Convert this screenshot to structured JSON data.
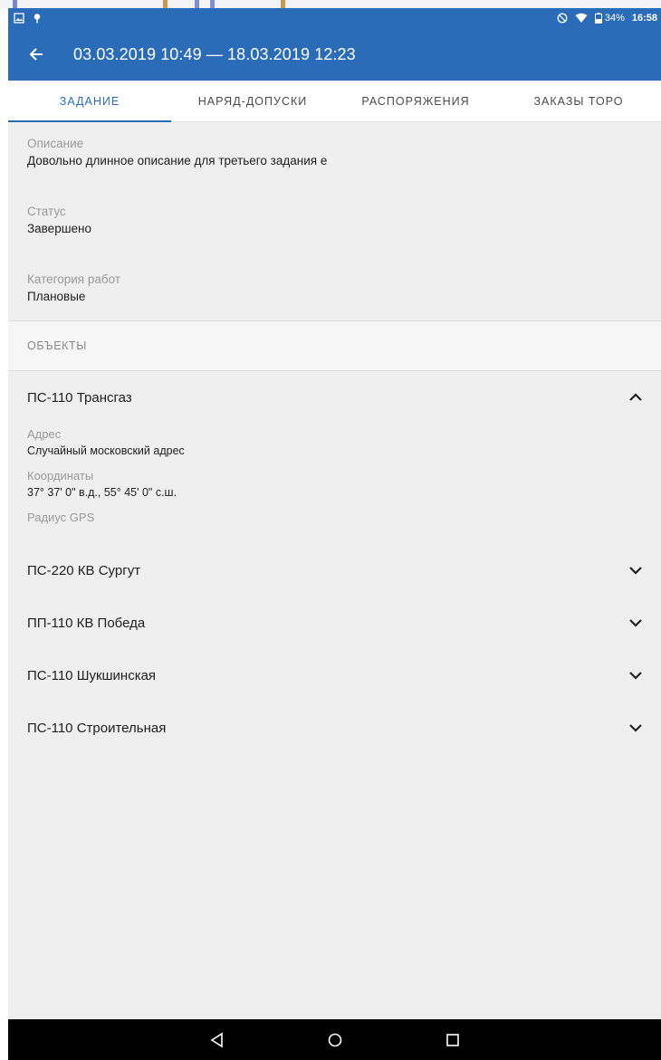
{
  "status_bar": {
    "battery": "34%",
    "time": "16:58",
    "left_icons": [
      "gallery-icon",
      "location-pin-icon"
    ],
    "right_icons": [
      "do-not-disturb-icon",
      "wifi-icon",
      "battery-icon"
    ]
  },
  "app_bar": {
    "title": "03.03.2019 10:49 — 18.03.2019 12:23",
    "back_icon": "arrow-left-icon"
  },
  "tabs": [
    {
      "label": "ЗАДАНИЕ",
      "active": true
    },
    {
      "label": "НАРЯД-ДОПУСКИ",
      "active": false
    },
    {
      "label": "РАСПОРЯЖЕНИЯ",
      "active": false
    },
    {
      "label": "ЗАКАЗЫ ТОРО",
      "active": false
    }
  ],
  "fields": [
    {
      "label": "Описание",
      "value": "Довольно длинное описание для третьего задания е"
    },
    {
      "label": "Статус",
      "value": "Завершено"
    },
    {
      "label": "Категория работ",
      "value": "Плановые"
    }
  ],
  "objects_section": {
    "title": "ОБЪЕКТЫ",
    "items": [
      {
        "title": "ПС-110 Трансгаз",
        "expanded": true,
        "details": [
          {
            "label": "Адрес",
            "value": "Случайный московский адрес"
          },
          {
            "label": "Координаты",
            "value": "37° 37' 0\" в.д., 55° 45' 0\" с.ш."
          },
          {
            "label": "Радиус GPS",
            "value": ""
          }
        ]
      },
      {
        "title": "ПС-220 КВ Сургут",
        "expanded": false
      },
      {
        "title": "ПП-110 КВ Победа",
        "expanded": false
      },
      {
        "title": "ПС-110 Шукшинская",
        "expanded": false
      },
      {
        "title": "ПС-110 Строительная",
        "expanded": false
      }
    ]
  },
  "nav_bar": {
    "buttons": [
      "back-triangle-icon",
      "home-circle-icon",
      "recents-square-icon"
    ]
  },
  "colors": {
    "primary": "#2b6cb8",
    "background": "#efefef",
    "label": "#9a9a9a",
    "text": "#212121"
  }
}
